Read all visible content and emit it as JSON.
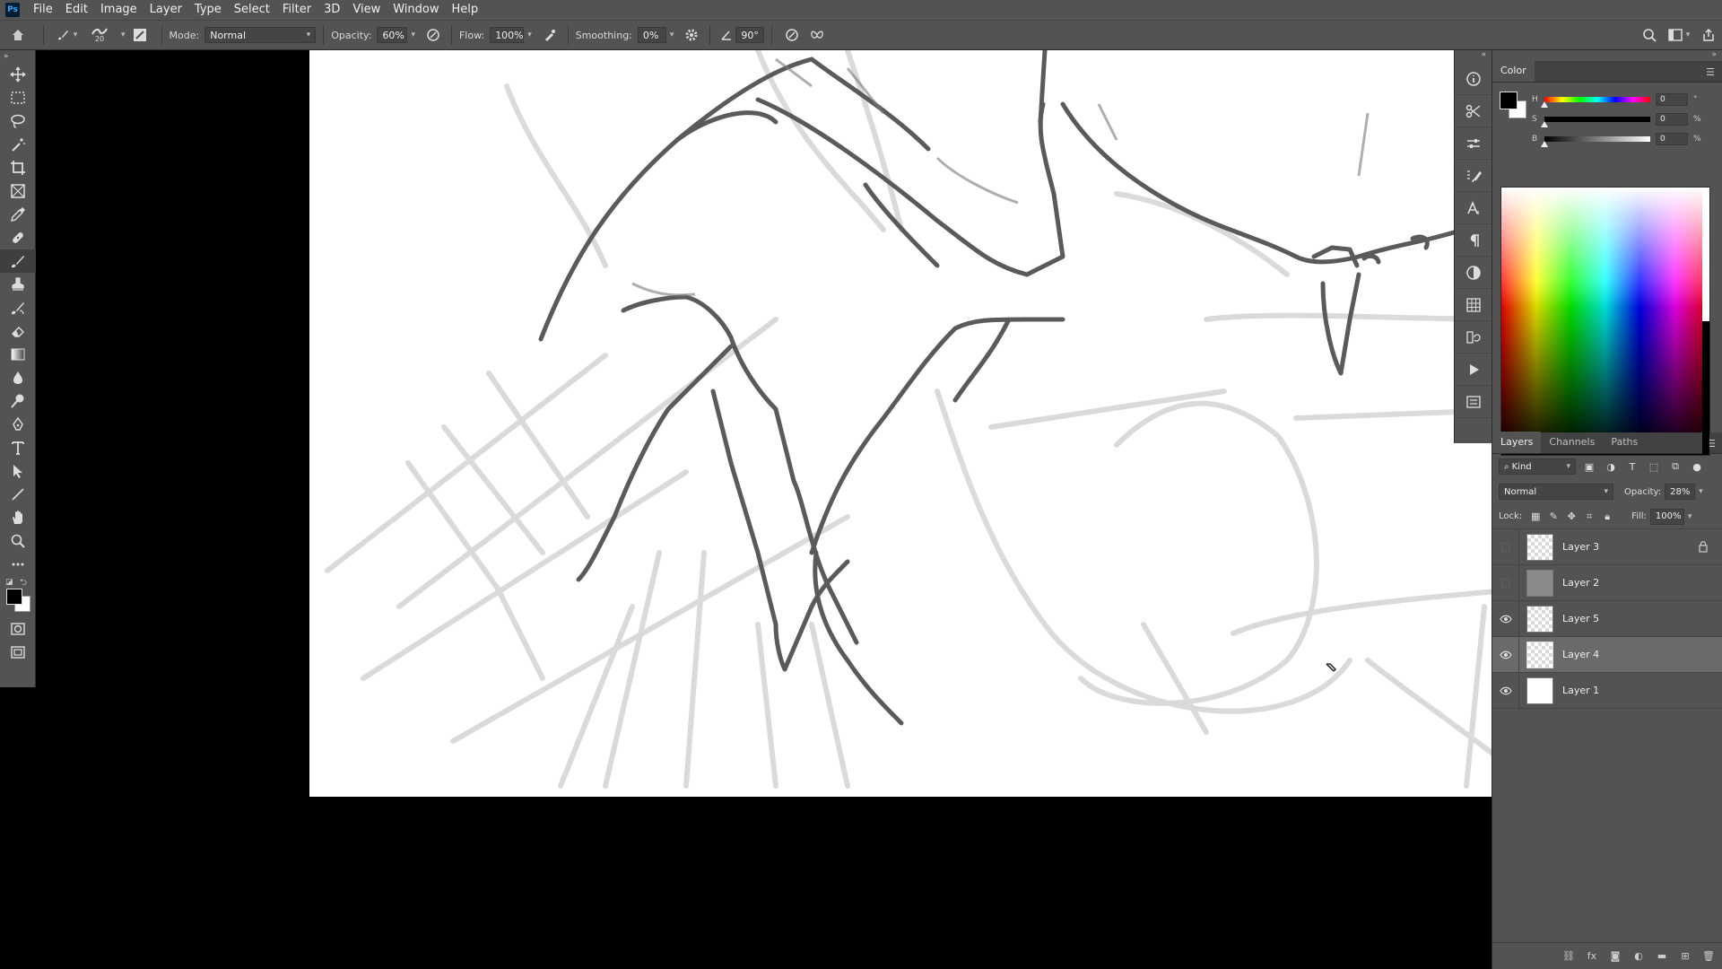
{
  "app": {
    "logo": "Ps"
  },
  "menu": [
    "File",
    "Edit",
    "Image",
    "Layer",
    "Type",
    "Select",
    "Filter",
    "3D",
    "View",
    "Window",
    "Help"
  ],
  "options": {
    "brush_size": "20",
    "mode_label": "Mode:",
    "mode_value": "Normal",
    "opacity_label": "Opacity:",
    "opacity_value": "60%",
    "flow_label": "Flow:",
    "flow_value": "100%",
    "smoothing_label": "Smoothing:",
    "smoothing_value": "0%",
    "angle_value": "90°"
  },
  "color_panel": {
    "tab": "Color",
    "h_letter": "H",
    "h_value": "0",
    "h_unit": "°",
    "s_letter": "S",
    "s_value": "0",
    "s_unit": "%",
    "b_letter": "B",
    "b_value": "0",
    "b_unit": "%",
    "foreground": "#000000",
    "background": "#ffffff"
  },
  "layers_panel": {
    "tabs": [
      "Layers",
      "Channels",
      "Paths"
    ],
    "filter_kind": "Kind",
    "blend_mode": "Normal",
    "opacity_label": "Opacity:",
    "opacity_value": "28%",
    "lock_label": "Lock:",
    "fill_label": "Fill:",
    "fill_value": "100%",
    "layers": [
      {
        "name": "Layer 3",
        "visible": false,
        "locked": true,
        "selected": false
      },
      {
        "name": "Layer 2",
        "visible": false,
        "locked": false,
        "selected": false
      },
      {
        "name": "Layer 5",
        "visible": true,
        "locked": false,
        "selected": false
      },
      {
        "name": "Layer 4",
        "visible": true,
        "locked": false,
        "selected": true
      },
      {
        "name": "Layer 1",
        "visible": true,
        "locked": false,
        "selected": false
      }
    ]
  }
}
